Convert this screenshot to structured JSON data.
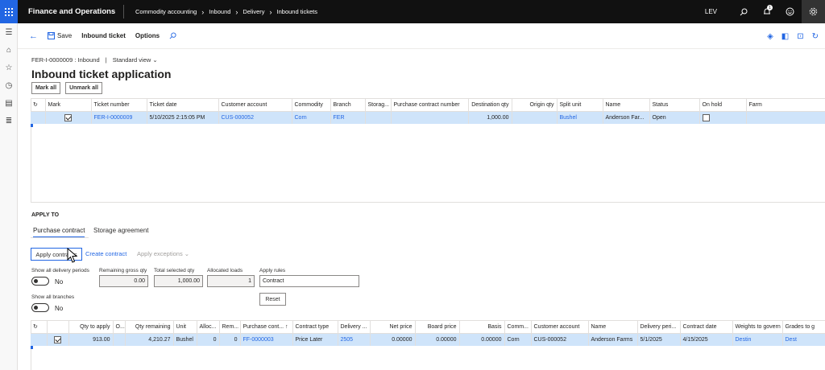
{
  "topbar": {
    "app_title": "Finance and Operations",
    "breadcrumbs": [
      "Commodity accounting",
      "Inbound",
      "Delivery",
      "Inbound tickets"
    ],
    "company": "LEV",
    "notification_count": "1",
    "icons": [
      "search-icon",
      "bell-icon",
      "smiley-icon",
      "gear-icon"
    ]
  },
  "actionbar": {
    "save_label": "Save",
    "inbound_ticket_label": "Inbound ticket",
    "options_label": "Options"
  },
  "page": {
    "record_crumb": "FER-I-0000009 : Inbound",
    "view_label": "Standard view",
    "title": "Inbound ticket application",
    "mark_all": "Mark all",
    "unmark_all": "Unmark all"
  },
  "top_grid": {
    "columns": [
      "Mark",
      "Ticket number",
      "Ticket date",
      "Customer account",
      "Commodity",
      "Branch",
      "Storag...",
      "Purchase contract number",
      "Destination qty",
      "Origin qty",
      "Split unit",
      "Name",
      "Status",
      "On hold",
      "Farm"
    ],
    "rows": [
      {
        "ticket_number": "FER-I-0000009",
        "ticket_date": "5/10/2025 2:15:05 PM",
        "customer_account": "CUS-000052",
        "commodity": "Corn",
        "branch": "FER",
        "storage": "",
        "purchase_contract_number": "",
        "destination_qty": "1,000.00",
        "origin_qty": "",
        "split_unit": "Bushel",
        "name": "Anderson Far...",
        "status": "Open",
        "farm": ""
      }
    ]
  },
  "apply_to": {
    "heading": "APPLY TO",
    "tabs": [
      "Purchase contract",
      "Storage agreement"
    ],
    "apply_contracts": "Apply contracts",
    "create_contract": "Create contract",
    "apply_exceptions": "Apply exceptions",
    "show_all_delivery_periods": "Show all delivery periods",
    "show_all_delivery_periods_value": "No",
    "show_all_branches": "Show all branches",
    "show_all_branches_value": "No",
    "remaining_gross_qty_label": "Remaining gross qty",
    "remaining_gross_qty": "0.00",
    "total_selected_qty_label": "Total selected qty",
    "total_selected_qty": "1,000.00",
    "allocated_loads_label": "Allocated loads",
    "allocated_loads": "1",
    "apply_rules_label": "Apply rules",
    "apply_rules": "Contract",
    "reset": "Reset"
  },
  "bottom_grid": {
    "columns": [
      "Qty to apply",
      "O...",
      "Qty remaining",
      "Unit",
      "Alloc...",
      "Rem...",
      "Purchase cont...",
      "Contract type",
      "Delivery ...",
      "Net price",
      "Board price",
      "Basis",
      "Comm...",
      "Customer account",
      "Name",
      "Delivery peri...",
      "Contract date",
      "Weights to govern",
      "Grades to g"
    ],
    "rows": [
      {
        "qty_to_apply": "913.00",
        "o": "",
        "qty_remaining": "4,210.27",
        "unit": "Bushel",
        "alloc": "0",
        "rem": "0",
        "purchase_contract": "FF-0000003",
        "contract_type": "Price Later",
        "delivery": "2505",
        "net_price": "0.00000",
        "board_price": "0.00000",
        "basis": "0.00000",
        "commodity": "Corn",
        "customer_account": "CUS-000052",
        "name": "Anderson Farms",
        "delivery_period": "5/1/2025",
        "contract_date": "4/15/2025",
        "weights": "Destin",
        "grades": "Dest"
      }
    ]
  }
}
